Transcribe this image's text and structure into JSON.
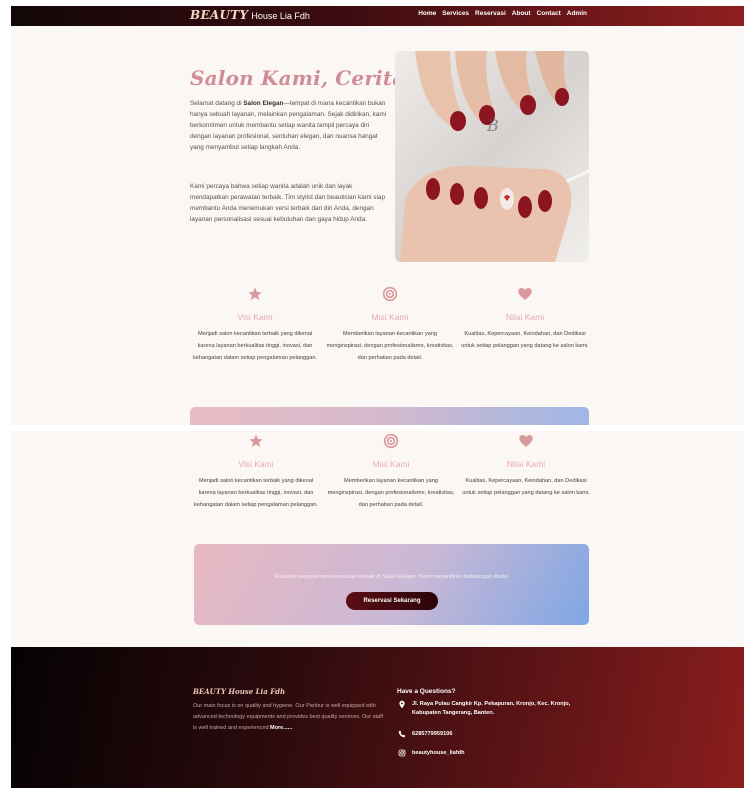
{
  "navbar": {
    "brand_script": "BEAUTY",
    "brand_rest": "House Lia Fdh",
    "links": [
      "Home",
      "Services",
      "Reservasi",
      "About",
      "Contact",
      "Admin"
    ]
  },
  "hero": {
    "title": "Salon Kami, Cerita Kami",
    "p1_intro": "Selamat datang di ",
    "p1_strong": "Salon Elegan",
    "p1_rest": "—tempat di mana kecantikan bukan hanya sebuah layanan, melainkan pengalaman. Sejak didirikan, kami berkomitmen untuk membantu setiap wanita tampil percaya diri dengan layanan profesional, sentuhan elegan, dan nuansa hangat yang menyambut setiap langkah Anda.",
    "p2": "Kami percaya bahwa setiap wanita adalah unik dan layak mendapatkan perawatan terbaik. Tim stylist dan beautician kami siap membantu Anda menemukan versi terbaik dari diri Anda, dengan layanan personalisasi sesuai kebutuhan dan gaya hidup Anda."
  },
  "features": [
    {
      "icon": "star-icon",
      "title": "Visi Kami",
      "desc": "Menjadi salon kecantikan terbaik yang dikenal karena layanan berkualitas tinggi, inovasi, dan kehangatan dalam setiap pengalaman pelanggan."
    },
    {
      "icon": "target-icon",
      "title": "Misi Kami",
      "desc": "Memberikan layanan kecantikan yang menginspirasi, dengan profesionalisme, kreativitas, dan perhatian pada detail."
    },
    {
      "icon": "heart-icon",
      "title": "Nilai Kami",
      "desc": "Kualitas, Kepercayaan, Keindahan, dan Dedikasi untuk setiap pelanggan yang datang ke salon kami."
    }
  ],
  "cta": {
    "heading": "",
    "text": "Rasakan pengalaman perawatan terbaik di Salon Elegan. Kami menantikan kedatangan Anda!",
    "button": "Reservasi Sekarang"
  },
  "footer": {
    "brand": "BEAUTY House Lia Fdh",
    "desc": "Our main focus is on quality and hygiene. Our Parlour is well equipped with advanced technology equipments and provides best quality services. Our staff is well trained and experienced ",
    "more": "More......",
    "questions_title": "Have a Questions?",
    "address": "Jl. Raya Pulau Cangkir Kp. Pekapuran, Kronjo, Kec. Kronjo, Kabupaten Tangerang, Banten.",
    "phone": "6285779959106",
    "instagram": "beautyhouse_liafdh"
  },
  "colors": {
    "accent_pink": "#e7a9ad",
    "title_pink": "#d08d95",
    "dark_red": "#5a0e14",
    "icon_pink": "#d99a9c"
  }
}
